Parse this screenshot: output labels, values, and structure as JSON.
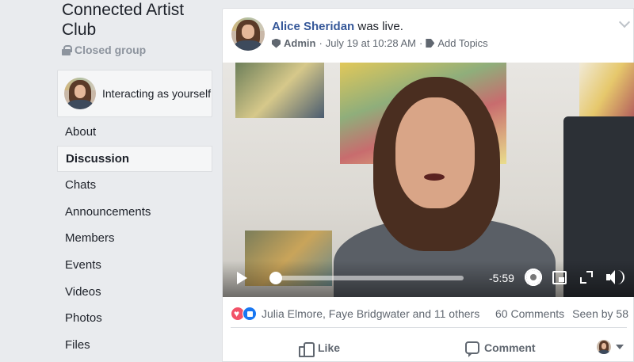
{
  "group": {
    "title": "Connected Artist Club",
    "privacy": "Closed group",
    "interacting_as": "Interacting as yourself"
  },
  "nav": {
    "items": [
      {
        "label": "About"
      },
      {
        "label": "Discussion",
        "active": true
      },
      {
        "label": "Chats"
      },
      {
        "label": "Announcements"
      },
      {
        "label": "Members"
      },
      {
        "label": "Events"
      },
      {
        "label": "Videos"
      },
      {
        "label": "Photos"
      },
      {
        "label": "Files"
      }
    ]
  },
  "post": {
    "author": "Alice Sheridan",
    "action": " was live.",
    "role": "Admin",
    "timestamp": "July 19 at 10:28 AM",
    "add_topics": "Add Topics",
    "video": {
      "time_remaining": "-5:59",
      "progress": 0.02
    },
    "reactions": {
      "names": "Julia Elmore, Faye Bridgwater and 11 others",
      "comments": "60 Comments",
      "seen": "Seen by 58"
    },
    "actions": {
      "like": "Like",
      "comment": "Comment"
    }
  },
  "icons": {
    "lock": "lock-icon",
    "admin": "shield-icon",
    "tag": "tag-icon",
    "chevron": "chevron-down-icon",
    "play": "play-icon",
    "settings": "gear-icon",
    "pip": "picture-in-picture-icon",
    "fullscreen": "fullscreen-icon",
    "volume": "volume-icon",
    "love": "love-reaction-icon",
    "like": "like-reaction-icon",
    "like_action": "thumbs-up-icon",
    "comment_action": "comment-icon"
  },
  "colors": {
    "link": "#365899",
    "love": "#f25268",
    "like": "#1877f2",
    "background": "#e9ebee"
  }
}
